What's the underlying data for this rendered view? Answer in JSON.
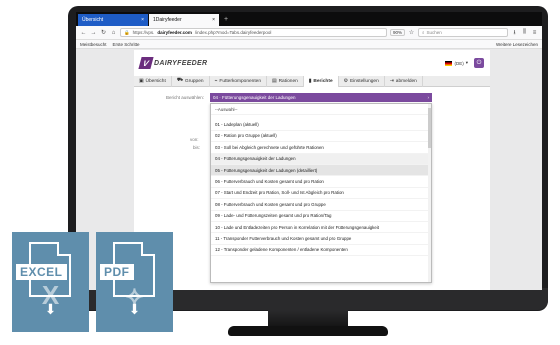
{
  "browser": {
    "tabs": [
      {
        "label": "Übersicht",
        "close": "×"
      },
      {
        "label": "1Dairyfeeder",
        "close": "×"
      }
    ],
    "new_tab": "+",
    "url_prefix": "https://vps.",
    "url_domain": "dairyfeeder.com",
    "url_rest": "/index.php?mod=Tabs.dairyfeederpool",
    "zoom": "90%",
    "search_placeholder": "Suchen",
    "bookmarks": [
      "Meistbesucht",
      "Erste Schritte"
    ],
    "other_bookmarks": "Weitere Lesezeichen"
  },
  "app": {
    "logo_mark": "V",
    "logo_text": "DAIRYFEEDER",
    "language": "(DE)",
    "nav": [
      {
        "icon": "▣",
        "label": "Übersicht"
      },
      {
        "icon": "⛟",
        "label": "Gruppen"
      },
      {
        "icon": "⌁",
        "label": "Futterkomponenten"
      },
      {
        "icon": "▤",
        "label": "Rationen"
      },
      {
        "icon": "▮",
        "label": "Berichte"
      },
      {
        "icon": "⚙",
        "label": "Einstellungen"
      },
      {
        "icon": "⇥",
        "label": "abmelden"
      }
    ],
    "report": {
      "label": "Bericht auswählen:",
      "selected": "04 · Fütterungsgenauigkeit der Ladungen",
      "side_labels": [
        "von:",
        "bis:"
      ],
      "options": [
        "--Auswahl--",
        "01 - Ladeplan (aktuell)",
        "02 - Ration pro Gruppe (aktuell)",
        "03 - Soll bei Abgleich gerechnete und geführte Rationen",
        "04 - Fütterungsgenauigkeit der Ladungen",
        "05 - Fütterungsgenauigkeit der Ladungen (detailliert)",
        "06 - Futterverbrauch und Kosten gesamt und pro Ration",
        "07 - Start und Endzeit pro Ration, Soll- und Ist Abgleich pro Ration",
        "08 - Futterverbrauch und Kosten gesamt und pro Gruppe",
        "09 - Lade- und Fütterungszeiten gesamt und pro Ration/Tag",
        "10 - Lade und Entladezeiten pro Person in Korrelation mit der Fütterungsgenauigkeit",
        "11 - Transponder Futterverbrauch und Kosten gesamt und pro Gruppe",
        "12 - Transponder geladene Komponenten / entladene Komponenten"
      ]
    }
  },
  "exports": {
    "excel": {
      "badge": "EXCEL",
      "letter": "X"
    },
    "pdf": {
      "badge": "PDF",
      "letter": "⟡"
    }
  },
  "colors": {
    "brand_purple": "#7b4a9e",
    "tile_blue": "#5f8eac",
    "tab_blue": "#1e5cc6"
  }
}
